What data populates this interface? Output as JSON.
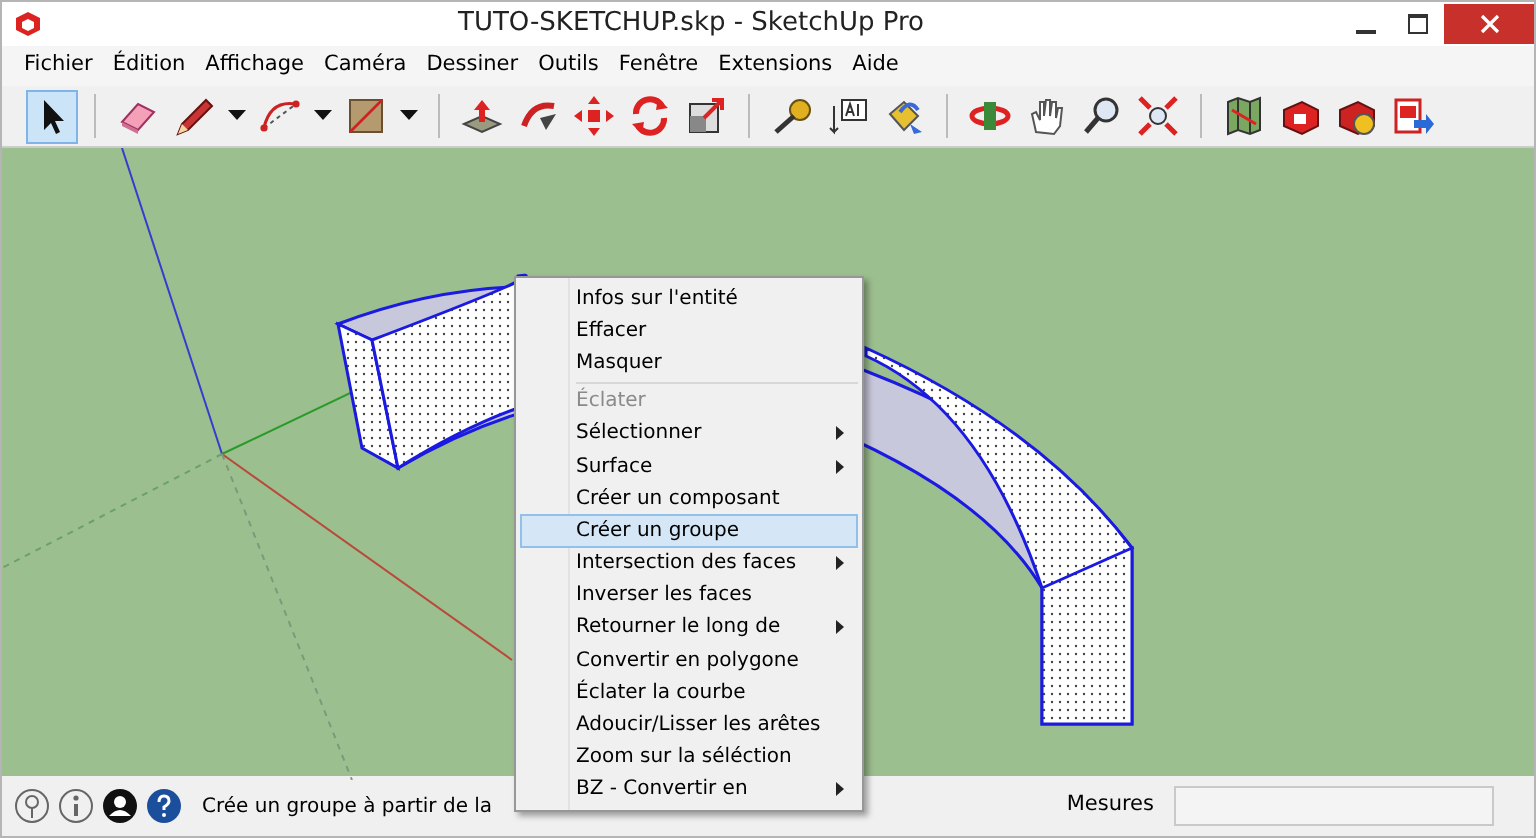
{
  "window": {
    "title": "TUTO-SKETCHUP.skp - SketchUp Pro"
  },
  "menu_bar": [
    "Fichier",
    "Édition",
    "Affichage",
    "Caméra",
    "Dessiner",
    "Outils",
    "Fenêtre",
    "Extensions",
    "Aide"
  ],
  "toolbar": {
    "groups": [
      [
        {
          "selected": true,
          "dropdown": false
        }
      ],
      [
        {
          "selected": false,
          "dropdown": false
        },
        {
          "selected": false,
          "dropdown": true
        },
        {
          "selected": false,
          "dropdown": true
        },
        {
          "selected": false,
          "dropdown": true
        }
      ],
      [
        {
          "selected": false,
          "dropdown": false
        },
        {
          "selected": false,
          "dropdown": false
        },
        {
          "selected": false,
          "dropdown": false
        },
        {
          "selected": false,
          "dropdown": false
        },
        {
          "selected": false,
          "dropdown": false
        }
      ],
      [
        {
          "selected": false,
          "dropdown": false
        },
        {
          "selected": false,
          "dropdown": false
        },
        {
          "selected": false,
          "dropdown": false
        }
      ],
      [
        {
          "selected": false,
          "dropdown": false
        },
        {
          "selected": false,
          "dropdown": false
        },
        {
          "selected": false,
          "dropdown": false
        },
        {
          "selected": false,
          "dropdown": false
        }
      ],
      [
        {
          "selected": false,
          "dropdown": false
        },
        {
          "selected": false,
          "dropdown": false
        },
        {
          "selected": false,
          "dropdown": false
        },
        {
          "selected": false,
          "dropdown": false
        }
      ]
    ]
  },
  "context_menu": {
    "items": [
      {
        "kind": "item",
        "label": "Infos sur l'entité",
        "disabled": false,
        "submenu": false,
        "selected": false
      },
      {
        "kind": "item",
        "label": "Effacer",
        "disabled": false,
        "submenu": false,
        "selected": false
      },
      {
        "kind": "item",
        "label": "Masquer",
        "disabled": false,
        "submenu": false,
        "selected": false
      },
      {
        "kind": "separator"
      },
      {
        "kind": "item",
        "label": "Éclater",
        "disabled": true,
        "submenu": false,
        "selected": false
      },
      {
        "kind": "item",
        "label": "Sélectionner",
        "disabled": false,
        "submenu": true,
        "selected": false
      },
      {
        "kind": "item",
        "label": "Surface",
        "disabled": false,
        "submenu": true,
        "selected": false
      },
      {
        "kind": "item",
        "label": "Créer un composant",
        "disabled": false,
        "submenu": false,
        "selected": false
      },
      {
        "kind": "item",
        "label": "Créer un groupe",
        "disabled": false,
        "submenu": false,
        "selected": true
      },
      {
        "kind": "item",
        "label": "Intersection des faces",
        "disabled": false,
        "submenu": true,
        "selected": false
      },
      {
        "kind": "item",
        "label": "Inverser les faces",
        "disabled": false,
        "submenu": false,
        "selected": false
      },
      {
        "kind": "item",
        "label": "Retourner le long de",
        "disabled": false,
        "submenu": true,
        "selected": false
      },
      {
        "kind": "item",
        "label": "Convertir en polygone",
        "disabled": false,
        "submenu": false,
        "selected": false
      },
      {
        "kind": "item",
        "label": "Éclater la courbe",
        "disabled": false,
        "submenu": false,
        "selected": false
      },
      {
        "kind": "item",
        "label": "Adoucir/Lisser les arêtes",
        "disabled": false,
        "submenu": false,
        "selected": false
      },
      {
        "kind": "item",
        "label": "Zoom sur la séléction",
        "disabled": false,
        "submenu": false,
        "selected": false
      },
      {
        "kind": "item",
        "label": "BZ - Convertir en",
        "disabled": false,
        "submenu": true,
        "selected": false
      }
    ]
  },
  "status_bar": {
    "message": "Crée un groupe à partir de la",
    "measure_label": "Mesures"
  }
}
